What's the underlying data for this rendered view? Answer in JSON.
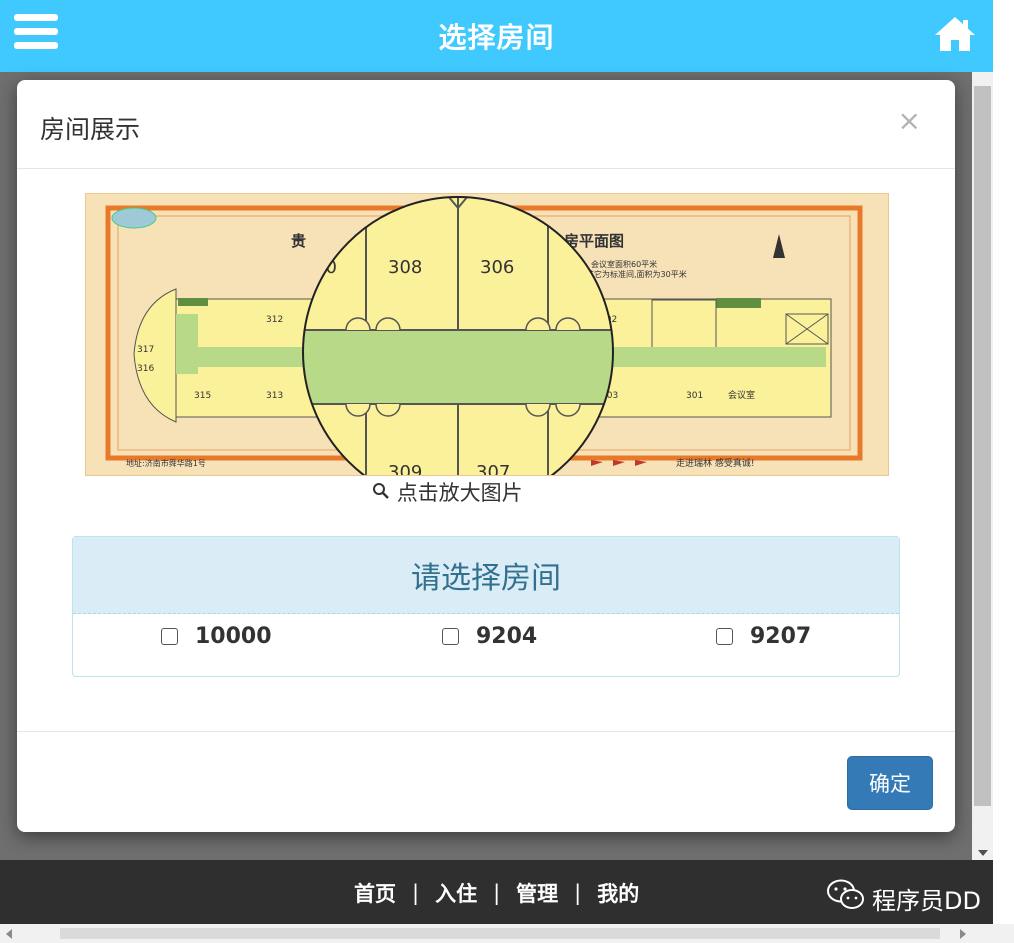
{
  "header": {
    "title": "选择房间"
  },
  "modal": {
    "title": "房间展示",
    "close_label": "×",
    "floorplan": {
      "heading_left": "贵",
      "heading_right": "房平面图",
      "rooms_top": [
        "312",
        "302"
      ],
      "rooms_bottom": [
        "315",
        "313",
        "303",
        "301"
      ],
      "rooms_left": [
        "317",
        "316"
      ],
      "meeting_room": "会议室",
      "note_line1": "会议室面积60平米",
      "note_line2": "其它为标准间,面积为30平米",
      "address": "地址:济南市舜华路1号",
      "slogan": "走进瑞林 感受真诚!",
      "magnifier_rooms": [
        "10",
        "308",
        "306",
        "309",
        "307"
      ]
    },
    "caption": "点击放大图片",
    "panel_title": "请选择房间",
    "rooms": [
      {
        "number": "10000",
        "checked": false
      },
      {
        "number": "9204",
        "checked": false
      },
      {
        "number": "9207",
        "checked": false
      }
    ],
    "confirm_label": "确定"
  },
  "bottom_nav": {
    "items": [
      "首页",
      "入住",
      "管理",
      "我的"
    ],
    "separator": "|"
  },
  "watermark": "程序员DD",
  "colors": {
    "header_bg": "#40c9ff",
    "panel_head_bg": "#daedf7",
    "panel_text": "#31708f",
    "confirm_bg": "#337ab7",
    "nav_bg": "#2f2f2f",
    "plan_yellow": "#fbf19a",
    "plan_green": "#b8d987",
    "plan_border": "#e8792a"
  }
}
